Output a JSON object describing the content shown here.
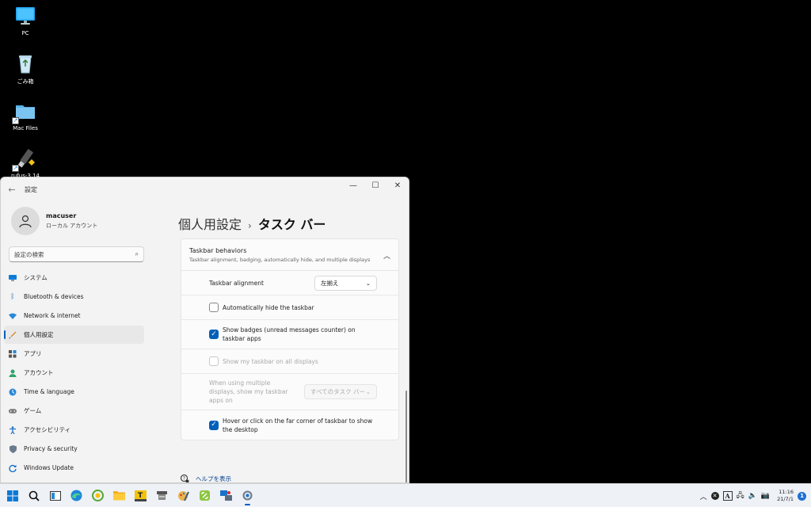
{
  "desktop": {
    "icons": [
      {
        "label": "PC"
      },
      {
        "label": "ごみ箱"
      },
      {
        "label": "Mac Files"
      },
      {
        "label": "rufus-3.14"
      }
    ]
  },
  "window": {
    "title": "設定",
    "user": {
      "name": "macuser",
      "account_type": "ローカル アカウント"
    },
    "search_placeholder": "設定の検索",
    "nav": [
      {
        "label": "システム",
        "icon": "monitor-icon"
      },
      {
        "label": "Bluetooth & devices",
        "icon": "bluetooth-icon"
      },
      {
        "label": "Network & internet",
        "icon": "wifi-icon"
      },
      {
        "label": "個人用設定",
        "icon": "brush-icon",
        "active": true
      },
      {
        "label": "アプリ",
        "icon": "apps-icon"
      },
      {
        "label": "アカウント",
        "icon": "person-icon"
      },
      {
        "label": "Time & language",
        "icon": "globe-icon"
      },
      {
        "label": "ゲーム",
        "icon": "gamepad-icon"
      },
      {
        "label": "アクセシビリティ",
        "icon": "accessibility-icon"
      },
      {
        "label": "Privacy & security",
        "icon": "shield-icon"
      },
      {
        "label": "Windows Update",
        "icon": "update-icon"
      }
    ],
    "breadcrumb": {
      "parent": "個人用設定",
      "separator": "›",
      "current": "タスク バー"
    },
    "section": {
      "title": "Taskbar behaviors",
      "subtitle": "Taskbar alignment, badging, automatically hide, and multiple displays",
      "alignment": {
        "label": "Taskbar alignment",
        "value": "左揃え"
      },
      "auto_hide": {
        "label": "Automatically hide the taskbar",
        "checked": false
      },
      "badges": {
        "label": "Show badges (unread messages counter) on taskbar apps",
        "checked": true
      },
      "all_displays": {
        "label": "Show my taskbar on all displays",
        "checked": false,
        "disabled": true
      },
      "multi_display": {
        "label": "When using multiple displays, show my taskbar apps on",
        "value": "すべてのタスク バー",
        "disabled": true
      },
      "far_corner": {
        "label": "Hover or click on the far corner of taskbar to show the desktop",
        "checked": true
      }
    },
    "help_link": "ヘルプを表示"
  },
  "taskbar": {
    "clock_time": "11:16",
    "clock_date": "21/7/1",
    "notification_count": "1",
    "ime": "A"
  }
}
